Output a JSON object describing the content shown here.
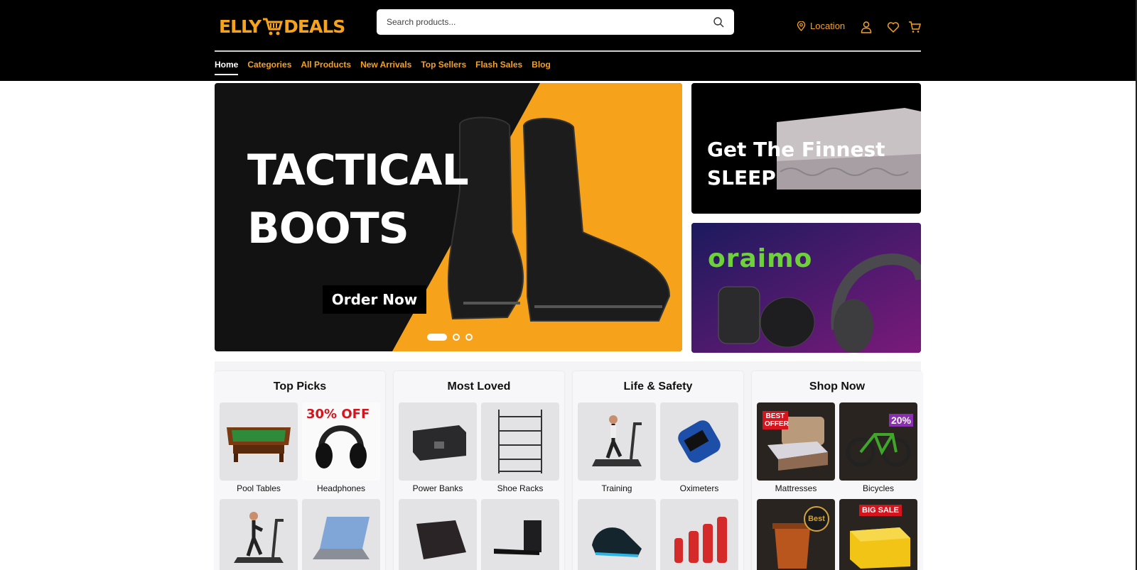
{
  "brand": {
    "logo_left": "ELLY",
    "logo_right": "DEALS",
    "accent": "#f7a21b"
  },
  "search": {
    "placeholder": "Search products..."
  },
  "header": {
    "location_label": "Location",
    "icons": [
      "location-pin-icon",
      "user-icon",
      "heart-icon",
      "cart-icon"
    ]
  },
  "nav": [
    "Home",
    "Categories",
    "All Products",
    "New Arrivals",
    "Top Sellers",
    "Flash Sales",
    "Blog"
  ],
  "hero": {
    "line1": "TACTICAL",
    "line2": "BOOTS",
    "cta": "Order Now",
    "slides": 3,
    "active_slide": 1
  },
  "promo1": {
    "line1": "Get The Finnest",
    "line2": "SLEEP"
  },
  "promo2": {
    "brand": "oraimo"
  },
  "categories": [
    {
      "title": "Top Picks",
      "items": [
        {
          "label": "Pool Tables",
          "badge": ""
        },
        {
          "label": "Headphones",
          "badge": "30% OFF"
        },
        {
          "label": "",
          "badge": ""
        },
        {
          "label": "",
          "badge": ""
        }
      ]
    },
    {
      "title": "Most Loved",
      "items": [
        {
          "label": "Power Banks",
          "badge": ""
        },
        {
          "label": "Shoe Racks",
          "badge": ""
        },
        {
          "label": "",
          "badge": ""
        },
        {
          "label": "",
          "badge": ""
        }
      ]
    },
    {
      "title": "Life & Safety",
      "items": [
        {
          "label": "Training",
          "badge": ""
        },
        {
          "label": "Oximeters",
          "badge": ""
        },
        {
          "label": "",
          "badge": ""
        },
        {
          "label": "",
          "badge": ""
        }
      ]
    },
    {
      "title": "Shop Now",
      "items": [
        {
          "label": "Mattresses",
          "badge": "BEST OFFER"
        },
        {
          "label": "Bicycles",
          "badge": "20%"
        },
        {
          "label": "",
          "badge": "Best"
        },
        {
          "label": "",
          "badge": "BIG SALE"
        }
      ]
    }
  ]
}
